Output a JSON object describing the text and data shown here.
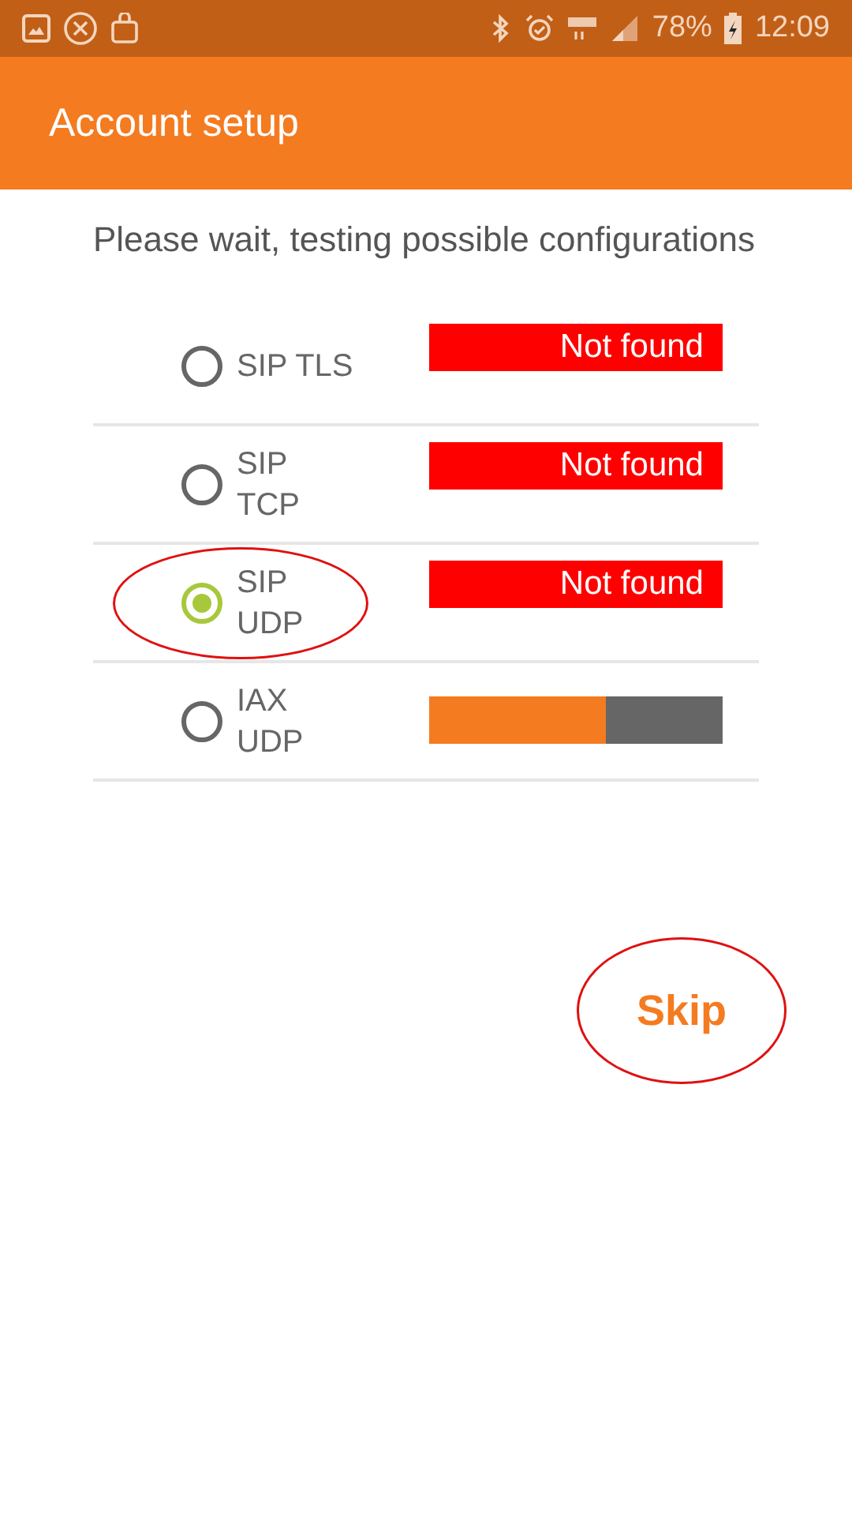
{
  "status_bar": {
    "battery": "78%",
    "time": "12:09"
  },
  "app_bar": {
    "title": "Account setup"
  },
  "message": "Please wait, testing possible configurations",
  "options": [
    {
      "label": "SIP TLS",
      "selected": false,
      "highlighted": false,
      "kind": "result",
      "result": "Not found"
    },
    {
      "label": "SIP TCP",
      "selected": false,
      "highlighted": false,
      "kind": "result",
      "result": "Not found"
    },
    {
      "label": "SIP UDP",
      "selected": true,
      "highlighted": true,
      "kind": "result",
      "result": "Not found"
    },
    {
      "label": "IAX UDP",
      "selected": false,
      "highlighted": false,
      "kind": "progress",
      "level": 0.6
    }
  ],
  "skip_button": {
    "label": "Skip",
    "highlighted": true
  }
}
